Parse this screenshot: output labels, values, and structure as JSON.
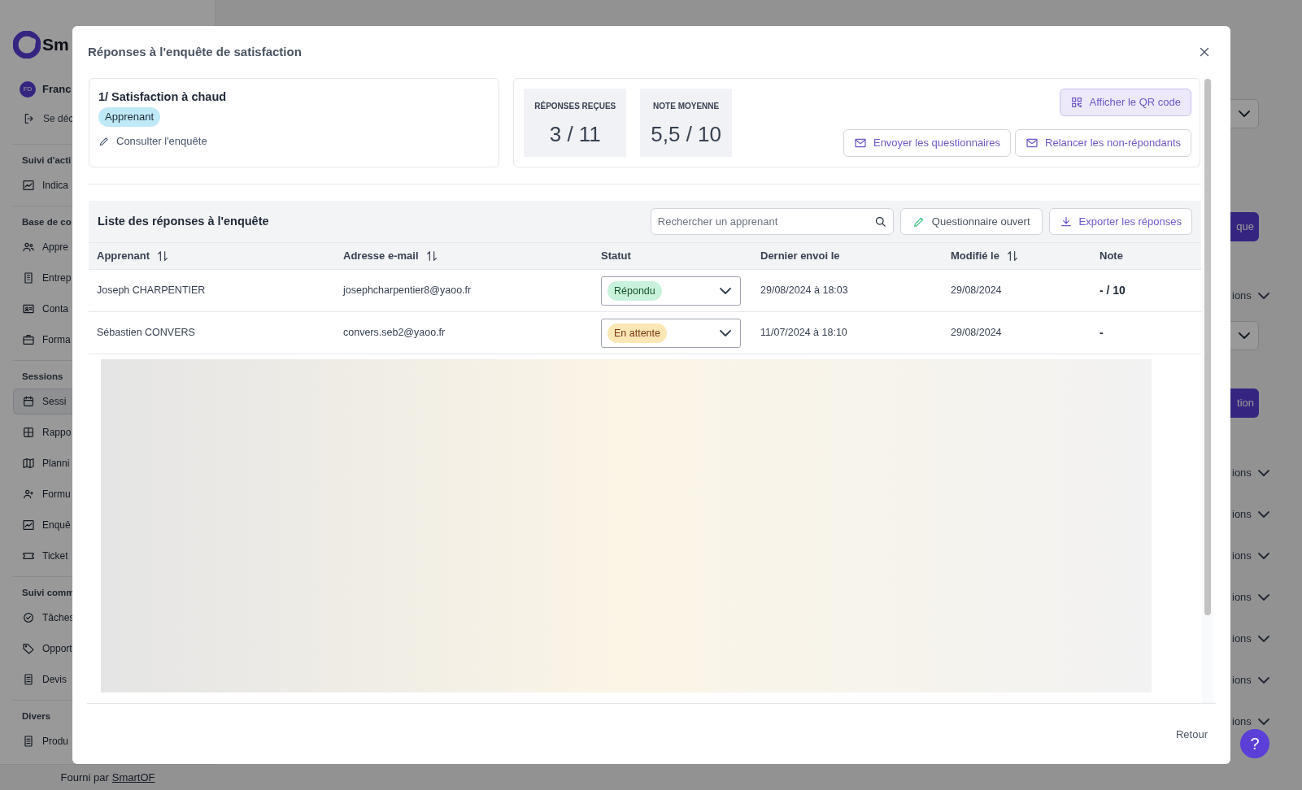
{
  "sidebar": {
    "logo": "Sm",
    "user": {
      "initials": "FD",
      "name": "Franc"
    },
    "logout": "Se déc",
    "sections": [
      {
        "title": "Suivi d'acti",
        "items": [
          {
            "label": "Indica",
            "selected": false
          }
        ]
      },
      {
        "title": "Base de co",
        "items": [
          {
            "label": "Appre",
            "selected": false
          },
          {
            "label": "Entrep",
            "selected": false
          },
          {
            "label": "Conta",
            "selected": false
          },
          {
            "label": "Forma",
            "selected": false
          }
        ]
      },
      {
        "title": "Sessions",
        "items": [
          {
            "label": "Sessi",
            "selected": true
          },
          {
            "label": "Rappo",
            "selected": false
          },
          {
            "label": "Planni",
            "selected": false
          },
          {
            "label": "Formu",
            "selected": false
          },
          {
            "label": "Enquê",
            "selected": false
          },
          {
            "label": "Ticket",
            "selected": false
          }
        ]
      },
      {
        "title": "Suivi comm",
        "items": [
          {
            "label": "Tâches",
            "selected": false
          },
          {
            "label": "Opport",
            "selected": false
          },
          {
            "label": "Devis",
            "selected": false
          }
        ]
      },
      {
        "title": "Divers",
        "items": [
          {
            "label": "Produ",
            "selected": false
          }
        ]
      }
    ],
    "footer": {
      "prefix": "Fourni par",
      "link": "SmartOF"
    }
  },
  "background": {
    "right_fragments": [
      {
        "kind": "dropdown"
      },
      {
        "kind": "button",
        "label": "que"
      },
      {
        "kind": "actions",
        "label": "ions"
      },
      {
        "kind": "dropdown"
      },
      {
        "kind": "button",
        "label": "tion"
      },
      {
        "kind": "actions",
        "label": "ions"
      },
      {
        "kind": "actions",
        "label": "ions"
      },
      {
        "kind": "actions",
        "label": "ions"
      },
      {
        "kind": "actions",
        "label": "ions"
      },
      {
        "kind": "actions",
        "label": "ions"
      },
      {
        "kind": "actions",
        "label": "ions"
      },
      {
        "kind": "actions",
        "label": "ions"
      }
    ]
  },
  "help_button": "?",
  "modal": {
    "title": "Réponses à l'enquête de satisfaction",
    "survey": {
      "title": "1/ Satisfaction à chaud",
      "audience": "Apprenant",
      "link": "Consulter l'enquête"
    },
    "stats": [
      {
        "label": "RÉPONSES REÇUES",
        "value": "3 / 11"
      },
      {
        "label": "NOTE MOYENNE",
        "value": "5,5 / 10"
      }
    ],
    "qr_button": "Afficher le QR code",
    "actions": [
      "Envoyer les questionnaires",
      "Relancer les non-répondants"
    ],
    "list": {
      "title": "Liste des réponses à l'enquête",
      "search": {
        "placeholder": "Rechercher un apprenant"
      },
      "open_button": "Questionnaire ouvert",
      "export_button": "Exporter les réponses",
      "columns": [
        {
          "label": "Apprenant",
          "sortable": true
        },
        {
          "label": "Adresse e-mail",
          "sortable": true
        },
        {
          "label": "Statut",
          "sortable": false
        },
        {
          "label": "Dernier envoi le",
          "sortable": false
        },
        {
          "label": "Modifié le",
          "sortable": true
        },
        {
          "label": "Note",
          "sortable": false
        }
      ],
      "rows": [
        {
          "name": "Joseph CHARPENTIER",
          "email": "josephcharpentier8@yaoo.fr",
          "status": {
            "label": "Répondu",
            "kind": "answered"
          },
          "last_sent": "29/08/2024 à 18:03",
          "modified": "29/08/2024",
          "note": "- / 10"
        },
        {
          "name": "Sébastien CONVERS",
          "email": "convers.seb2@yaoo.fr",
          "status": {
            "label": "En attente",
            "kind": "pending"
          },
          "last_sent": "11/07/2024 à 18:10",
          "modified": "29/08/2024",
          "note": "-"
        }
      ]
    },
    "footer_button": "Retour"
  }
}
